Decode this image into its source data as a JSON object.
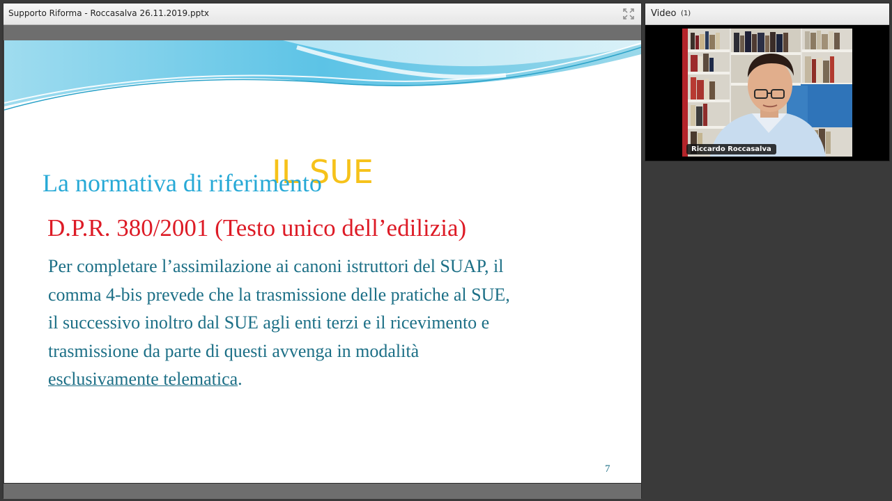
{
  "share_pod": {
    "title": "Supporto Riforma - Roccasalva 26.11.2019.pptx",
    "fullscreen_icon": "expand-icon"
  },
  "slide": {
    "title": "IL SUE",
    "subtitle": "La normativa di riferimento",
    "heading": "D.P.R. 380/2001 (Testo unico dell’edilizia)",
    "body_lines": [
      "Per completare l’assimilazione ai canoni istruttori del SUAP, il",
      "comma 4-bis prevede che la trasmissione delle pratiche al SUE,",
      "il successivo inoltro dal SUE agli enti terzi e il ricevimento e",
      "trasmissione da parte di questi avvenga in modalità"
    ],
    "body_last_underlined": "esclusivamente telematica",
    "body_last_tail": ".",
    "page_number": "7",
    "colors": {
      "title": "#f6c21a",
      "subtitle": "#27a9d6",
      "heading": "#dd1b26",
      "body": "#1c6f86"
    }
  },
  "video_pod": {
    "title": "Video",
    "count": "(1)",
    "participant_name": "Riccardo Roccasalva"
  }
}
